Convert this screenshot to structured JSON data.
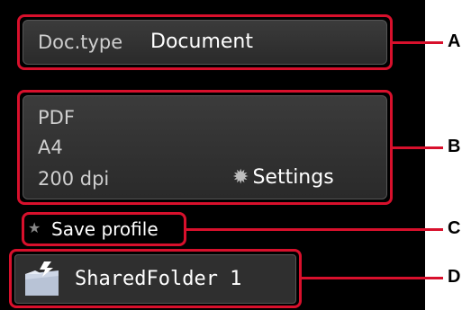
{
  "doc_type": {
    "label": "Doc.type",
    "value": "Document"
  },
  "scan_settings": {
    "format": "PDF",
    "size": "A4",
    "resolution": "200 dpi",
    "settings_label": "Settings",
    "settings_icon": "gear-icon"
  },
  "save_profile": {
    "label": "Save profile",
    "icon": "star-icon"
  },
  "destination": {
    "label": "SharedFolder 1",
    "icon": "folder-icon"
  },
  "callouts": [
    "A",
    "B",
    "C",
    "D"
  ],
  "colors": {
    "callout": "#d8102c",
    "panel": "#333333",
    "screen": "#000000"
  }
}
